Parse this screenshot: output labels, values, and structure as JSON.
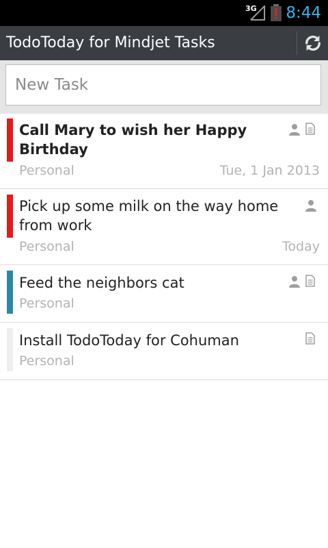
{
  "status_bar": {
    "network": "3G",
    "time": "8:44",
    "colors": {
      "time": "#33b5e5",
      "battery_alert": "#e02020"
    }
  },
  "action_bar": {
    "title": "TodoToday for Mindjet Tasks",
    "refresh_icon": "refresh-icon"
  },
  "new_task": {
    "placeholder": "New Task",
    "value": ""
  },
  "tasks": [
    {
      "title": "Call Mary to wish her Happy Birthday",
      "category": "Personal",
      "due": "Tue, 1 Jan 2013",
      "priority_color": "#e31b1b",
      "bold": true,
      "icons": [
        "person-icon",
        "note-icon"
      ]
    },
    {
      "title": "Pick up some milk on the way home from work",
      "category": "Personal",
      "due": "Today",
      "priority_color": "#e31b1b",
      "bold": false,
      "icons": [
        "person-icon"
      ]
    },
    {
      "title": "Feed the neighbors cat",
      "category": "Personal",
      "due": "",
      "priority_color": "#2b8aa3",
      "bold": false,
      "icons": [
        "assigned-person-icon",
        "note-icon"
      ]
    },
    {
      "title": "Install TodoToday for Cohuman",
      "category": "Personal",
      "due": "",
      "priority_color": "#eeeeee",
      "bold": false,
      "icons": [
        "note-icon"
      ]
    }
  ]
}
